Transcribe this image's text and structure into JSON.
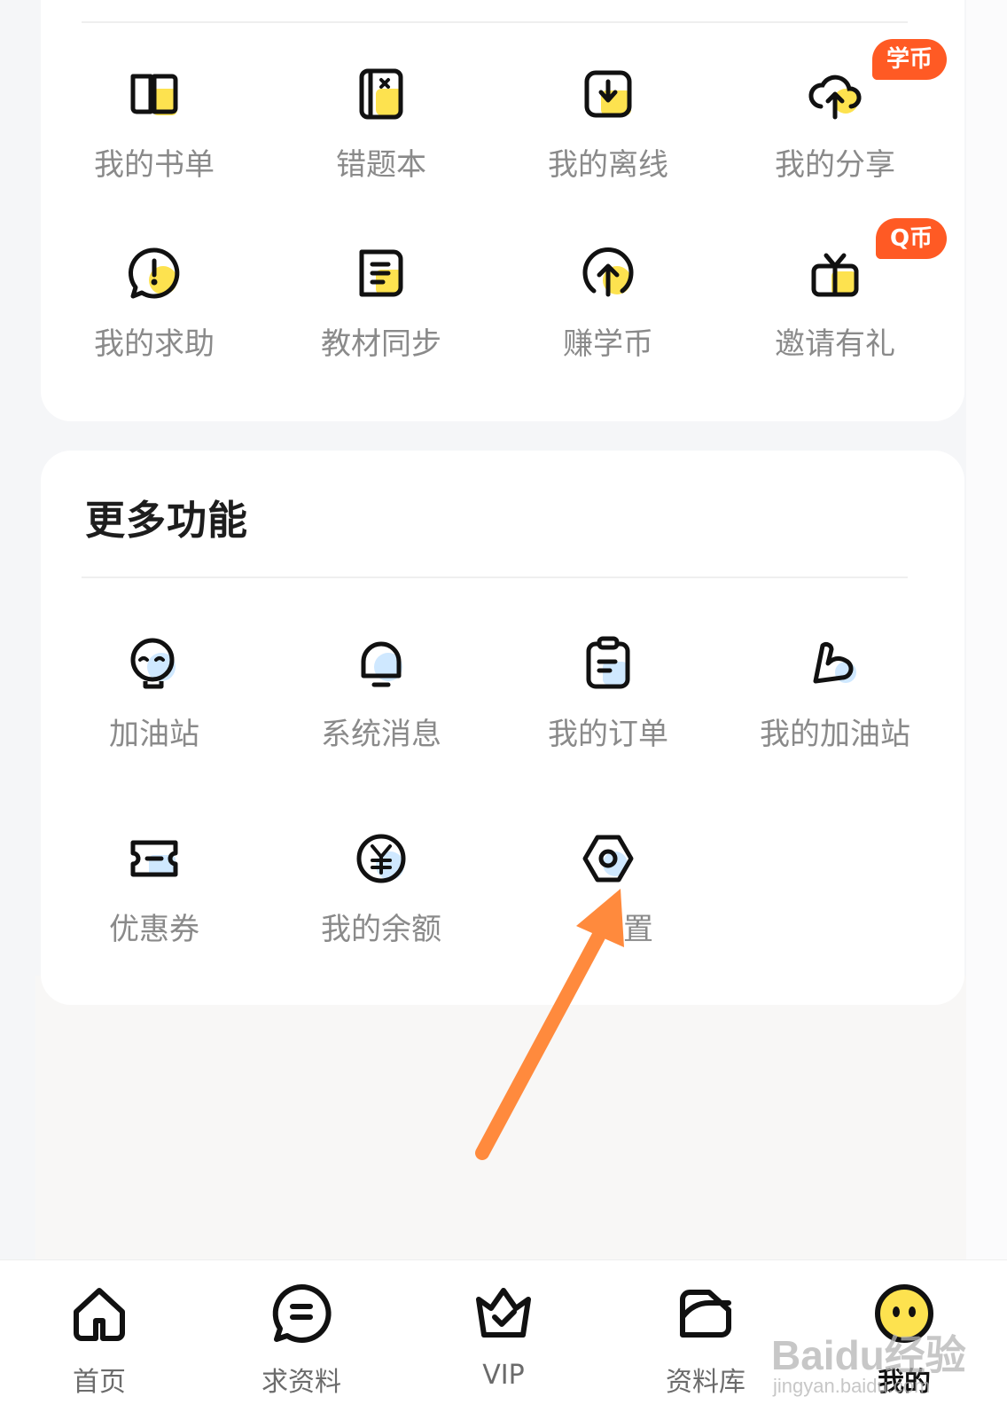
{
  "quick_grid": {
    "items": [
      {
        "label": "我的书单",
        "icon": "book-icon"
      },
      {
        "label": "错题本",
        "icon": "error-notebook-icon"
      },
      {
        "label": "我的离线",
        "icon": "offline-download-icon"
      },
      {
        "label": "我的分享",
        "icon": "cloud-upload-icon",
        "badge": "学币"
      },
      {
        "label": "我的求助",
        "icon": "help-bubble-icon"
      },
      {
        "label": "教材同步",
        "icon": "textbook-sync-icon"
      },
      {
        "label": "赚学币",
        "icon": "earn-coin-icon"
      },
      {
        "label": "邀请有礼",
        "icon": "gift-icon",
        "badge": "Q币"
      }
    ]
  },
  "more_section": {
    "title": "更多功能",
    "items": [
      {
        "label": "加油站",
        "icon": "mascot-face-icon"
      },
      {
        "label": "系统消息",
        "icon": "bell-icon"
      },
      {
        "label": "我的订单",
        "icon": "clipboard-icon"
      },
      {
        "label": "我的加油站",
        "icon": "muscle-arm-icon"
      },
      {
        "label": "优惠券",
        "icon": "coupon-icon"
      },
      {
        "label": "我的余额",
        "icon": "yuan-coin-icon"
      },
      {
        "label": "置",
        "icon": "settings-hex-icon"
      }
    ]
  },
  "bottom_nav": {
    "items": [
      {
        "label": "首页",
        "icon": "home-icon"
      },
      {
        "label": "求资料",
        "icon": "chat-request-icon"
      },
      {
        "label": "VIP",
        "icon": "vip-crown-icon"
      },
      {
        "label": "资料库",
        "icon": "folder-icon"
      },
      {
        "label": "我的",
        "icon": "profile-face-icon",
        "active": true
      }
    ]
  },
  "watermark": {
    "brand": "Baidu经验",
    "sub": "jingyan.baidu.com"
  },
  "colors": {
    "badge": "#ff5a24",
    "accent_yellow": "#fde24f",
    "accent_blue": "#cfe8ff",
    "arrow": "#ff8a3d",
    "label_gray": "#8a8a8a"
  }
}
